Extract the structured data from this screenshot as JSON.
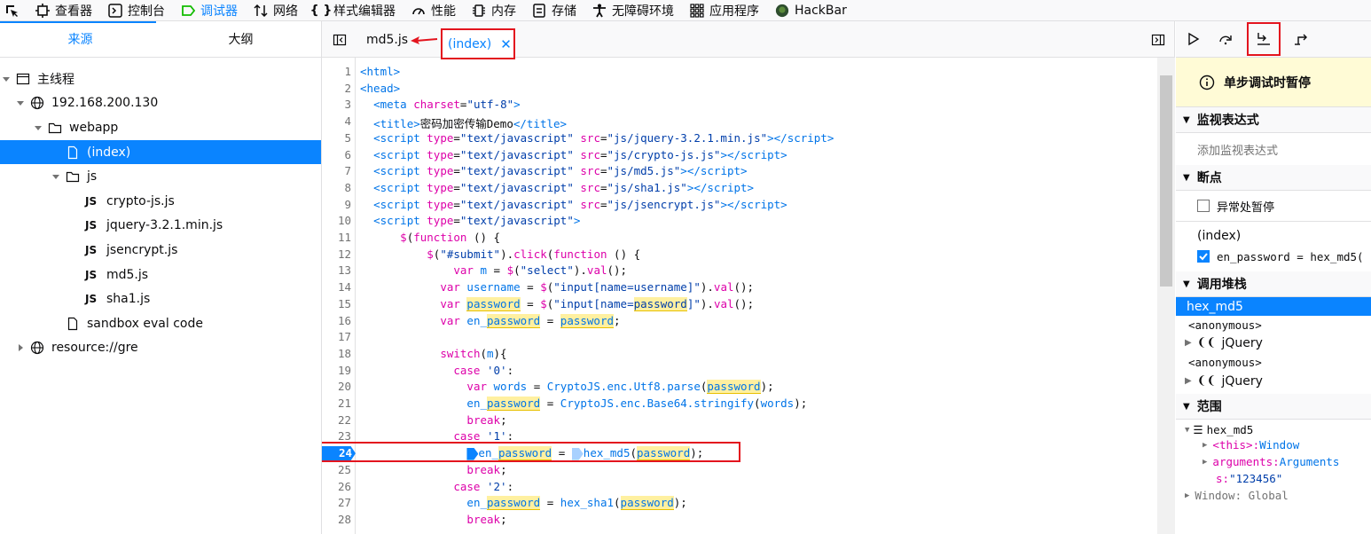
{
  "toolbar": {
    "items": [
      {
        "label": "查看器",
        "icon": "inspector-icon"
      },
      {
        "label": "控制台",
        "icon": "console-icon"
      },
      {
        "label": "调试器",
        "icon": "debugger-icon"
      },
      {
        "label": "网络",
        "icon": "network-icon"
      },
      {
        "label": "样式编辑器",
        "icon": "style-editor-icon"
      },
      {
        "label": "性能",
        "icon": "performance-icon"
      },
      {
        "label": "内存",
        "icon": "memory-icon"
      },
      {
        "label": "存储",
        "icon": "storage-icon"
      },
      {
        "label": "无障碍环境",
        "icon": "accessibility-icon"
      },
      {
        "label": "应用程序",
        "icon": "application-icon"
      },
      {
        "label": "HackBar",
        "icon": "hackbar-icon"
      }
    ],
    "accent": "#0a84ff"
  },
  "left_panel": {
    "tabs": [
      "来源",
      "大纲"
    ],
    "tree": [
      {
        "label": "主线程"
      },
      {
        "label": "192.168.200.130"
      },
      {
        "label": "webapp"
      },
      {
        "label": "(index)"
      },
      {
        "label": "js"
      },
      {
        "label": "crypto-js.js"
      },
      {
        "label": "jquery-3.2.1.min.js"
      },
      {
        "label": "jsencrypt.js"
      },
      {
        "label": "md5.js"
      },
      {
        "label": "sha1.js"
      },
      {
        "label": "sandbox eval code"
      },
      {
        "label": "resource://gre"
      }
    ],
    "js_badge": "JS"
  },
  "editor": {
    "tabs": [
      {
        "label": "md5.js"
      },
      {
        "label": "(index)"
      }
    ],
    "paused_line": "24",
    "line_numbers": [
      "1",
      "2",
      "3",
      "4",
      "5",
      "6",
      "7",
      "8",
      "9",
      "10",
      "11",
      "12",
      "13",
      "14",
      "15",
      "16",
      "17",
      "18",
      "19",
      "20",
      "21",
      "22",
      "23",
      "24",
      "25",
      "26",
      "27",
      "28"
    ]
  },
  "right_panel": {
    "pause_message": "单步调试时暂停",
    "sections": {
      "watch": "监视表达式",
      "watch_placeholder": "添加监视表达式",
      "breakpoints": "断点",
      "pause_on_exceptions": "异常处暂停",
      "bp_file": "(index)",
      "bp_expr": "en_password = hex_md5(",
      "call_stack": "调用堆栈",
      "scopes": "范围"
    },
    "call_stack": [
      {
        "label": "hex_md5"
      },
      {
        "label": "<anonymous>"
      },
      {
        "label": "jQuery"
      },
      {
        "label": "<anonymous>"
      },
      {
        "label": "jQuery"
      }
    ],
    "scopes": {
      "root": "hex_md5",
      "this_key": "<this>: ",
      "this_val": "Window",
      "args_key": "arguments: ",
      "args_val": "Arguments",
      "s_key": "s: ",
      "s_val": "\"123456\"",
      "window": "Window: Global"
    }
  }
}
